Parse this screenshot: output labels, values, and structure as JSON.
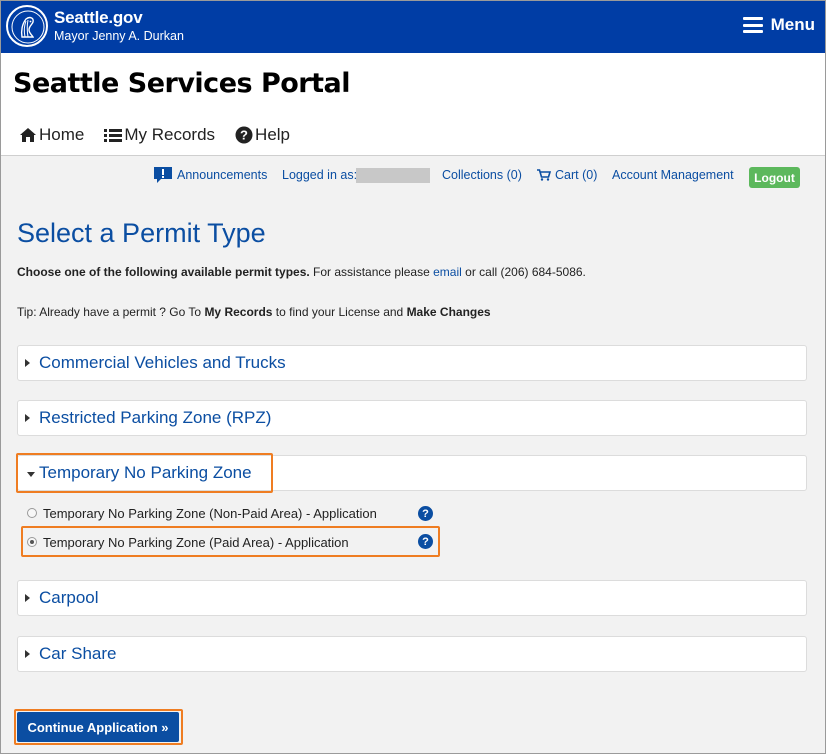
{
  "header": {
    "brand_title": "Seattle.gov",
    "brand_subtitle": "Mayor Jenny A. Durkan",
    "menu_label": "Menu",
    "seal_icon": "city-seal-icon"
  },
  "portal": {
    "title": "Seattle Services Portal",
    "nav": [
      {
        "label": "Home",
        "icon": "home-icon"
      },
      {
        "label": "My Records",
        "icon": "list-icon"
      },
      {
        "label": "Help",
        "icon": "question-circle-icon"
      }
    ]
  },
  "utility_bar": {
    "announcements": "Announcements",
    "logged_in_as": "Logged in as:",
    "collections": "Collections (0)",
    "cart": "Cart (0)",
    "account_management": "Account Management",
    "logout": "Logout"
  },
  "main": {
    "heading": "Select a Permit Type",
    "choose_bold": "Choose one of the following available permit types.",
    "choose_rest_1": " For assistance please ",
    "choose_link": "email",
    "choose_rest_2": " or call (206) 684-5086.",
    "tip_1": "Tip: Already have a permit ? Go To ",
    "tip_bold_1": "My Records",
    "tip_2": " to find your License and ",
    "tip_bold_2": "Make Changes",
    "categories": [
      {
        "label": "Commercial Vehicles and Trucks",
        "expanded": false
      },
      {
        "label": "Restricted Parking Zone (RPZ)",
        "expanded": false
      },
      {
        "label": "Temporary No Parking Zone",
        "expanded": true
      },
      {
        "label": "Carpool",
        "expanded": false
      },
      {
        "label": "Car Share",
        "expanded": false
      }
    ],
    "options": [
      {
        "label": "Temporary No Parking Zone (Non-Paid Area) - Application",
        "selected": false
      },
      {
        "label": "Temporary No Parking Zone (Paid Area) - Application",
        "selected": true
      }
    ],
    "help_glyph": "?",
    "continue_label": "Continue Application »"
  },
  "colors": {
    "brand_blue": "#003da5",
    "link_blue": "#0b4ea2",
    "highlight_orange": "#ef7d22",
    "logout_green": "#5cb85c",
    "content_bg": "#f2f2f2"
  }
}
